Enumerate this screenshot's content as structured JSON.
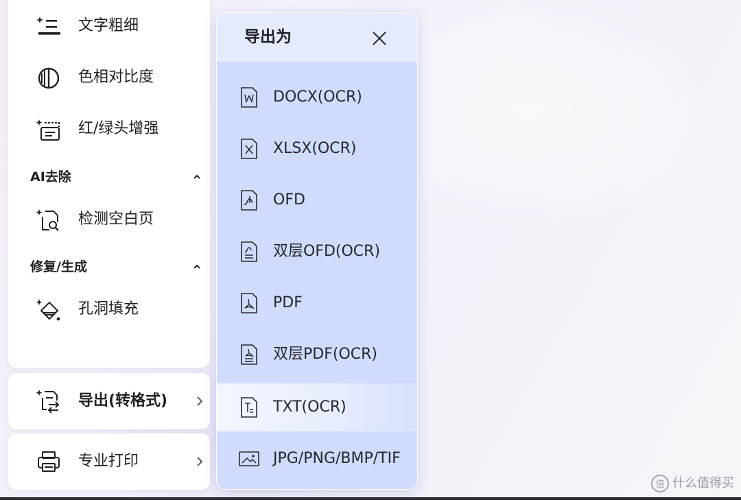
{
  "sidebar": {
    "items": [
      {
        "label": "文字粗细",
        "icon": "text-weight-icon"
      },
      {
        "label": "色相对比度",
        "icon": "hue-contrast-icon"
      },
      {
        "label": "红/绿头增强",
        "icon": "red-green-enhance-icon"
      }
    ],
    "sections": [
      {
        "title": "AI去除",
        "items": [
          {
            "label": "检测空白页",
            "icon": "blank-page-detect-icon"
          }
        ]
      },
      {
        "title": "修复/生成",
        "items": [
          {
            "label": "孔洞填充",
            "icon": "hole-fill-icon"
          }
        ]
      }
    ]
  },
  "cards": {
    "export": {
      "label": "导出(转格式)",
      "icon": "export-convert-icon"
    },
    "print": {
      "label": "专业打印",
      "icon": "printer-icon"
    }
  },
  "popup": {
    "title": "导出为",
    "items": [
      {
        "label": "DOCX(OCR)",
        "icon": "docx-file-icon"
      },
      {
        "label": "XLSX(OCR)",
        "icon": "xlsx-file-icon"
      },
      {
        "label": "OFD",
        "icon": "ofd-file-icon"
      },
      {
        "label": "双层OFD(OCR)",
        "icon": "dual-layer-ofd-icon"
      },
      {
        "label": "PDF",
        "icon": "pdf-file-icon"
      },
      {
        "label": "双层PDF(OCR)",
        "icon": "dual-layer-pdf-icon"
      },
      {
        "label": "TXT(OCR)",
        "icon": "txt-file-icon"
      },
      {
        "label": "JPG/PNG/BMP/TIF",
        "icon": "image-file-icon"
      }
    ],
    "selected_index": 6
  },
  "watermark": {
    "text": "什么值得买"
  },
  "colors": {
    "panel": "#ffffff",
    "popup_body": "#cfdcfb",
    "popup_header": "#e3ebfd",
    "text": "#1f1f24"
  }
}
